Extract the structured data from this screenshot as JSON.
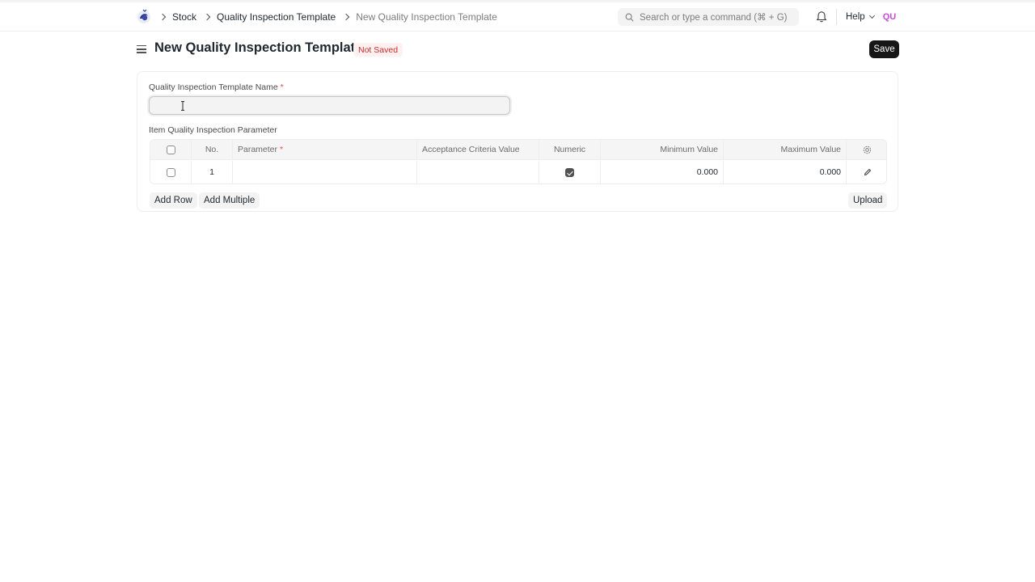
{
  "navbar": {
    "breadcrumbs": [
      "Stock",
      "Quality Inspection Template",
      "New Quality Inspection Template"
    ],
    "search_placeholder": "Search or type a command (⌘ + G)",
    "help_label": "Help",
    "avatar_initials": "QU"
  },
  "page": {
    "title": "New Quality Inspection Template",
    "status": "Not Saved",
    "save_label": "Save"
  },
  "form": {
    "template_name_label": "Quality Inspection Template Name",
    "template_name_value": "",
    "required_marker": "*",
    "table_label": "Item Quality Inspection Parameter",
    "table": {
      "columns": [
        "No.",
        "Parameter",
        "Acceptance Criteria Value",
        "Numeric",
        "Minimum Value",
        "Maximum Value"
      ],
      "rows": [
        {
          "no": "1",
          "parameter": "",
          "acceptance_criteria_value": "",
          "numeric": true,
          "minimum_value": "0.000",
          "maximum_value": "0.000"
        }
      ]
    },
    "add_row_label": "Add Row",
    "add_multiple_label": "Add Multiple",
    "upload_label": "Upload"
  },
  "colors": {
    "primary_button": "#171717",
    "status_badge_text": "#cc2929",
    "status_badge_bg": "#fff1ef",
    "avatar_text": "#c94ad8",
    "required_marker": "#e24c4c"
  }
}
